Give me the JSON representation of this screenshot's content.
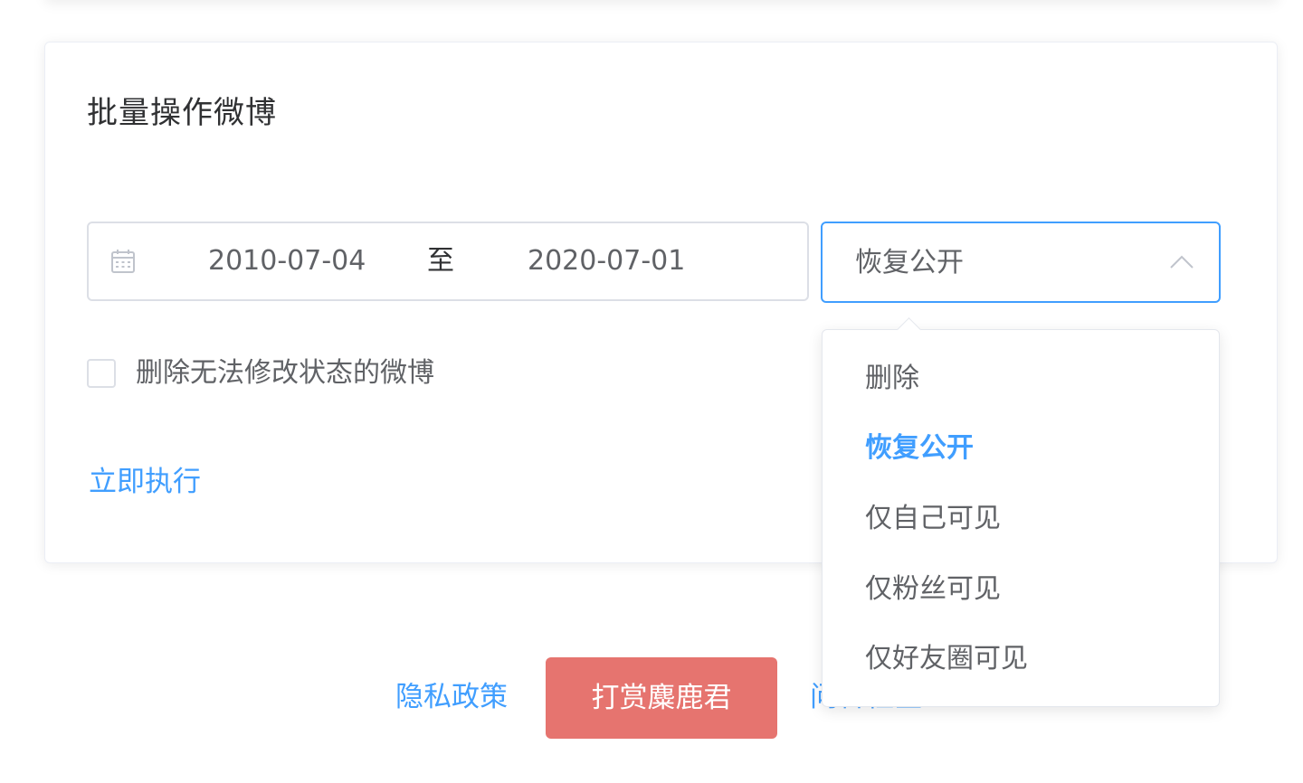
{
  "card": {
    "title": "批量操作微博",
    "date_range": {
      "start": "2010-07-04",
      "separator": "至",
      "end": "2020-07-01"
    },
    "action_select": {
      "value": "恢复公开",
      "options": [
        "删除",
        "恢复公开",
        "仅自己可见",
        "仅粉丝可见",
        "仅好友圈可见"
      ],
      "selected_index": 1
    },
    "checkbox": {
      "label": "删除无法修改状态的微博",
      "checked": false
    },
    "run_label": "立即执行"
  },
  "footer": {
    "privacy_label": "隐私政策",
    "donate_label": "打赏麋鹿君",
    "faq_label": "问答社区"
  },
  "icons": {
    "calendar": "calendar-icon",
    "chevron": "chevron-up-icon"
  },
  "colors": {
    "accent": "#409eff",
    "donate": "#e6746f",
    "border": "#dcdfe6"
  }
}
